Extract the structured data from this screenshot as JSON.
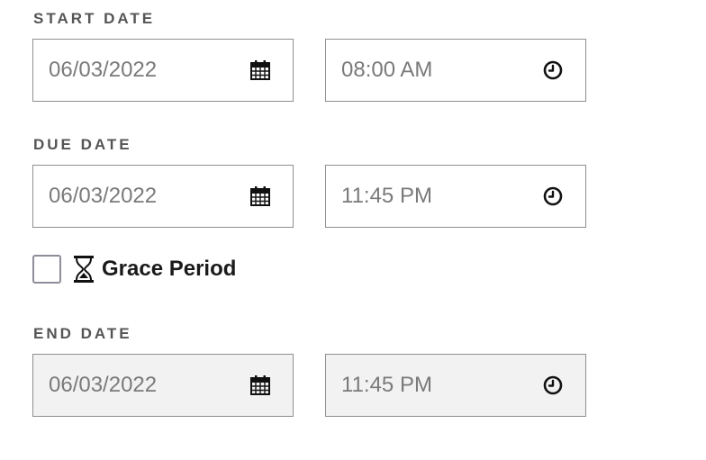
{
  "start_date": {
    "label": "START DATE",
    "date_value": "06/03/2022",
    "time_value": "08:00 AM"
  },
  "due_date": {
    "label": "DUE DATE",
    "date_value": "06/03/2022",
    "time_value": "11:45 PM"
  },
  "grace_period": {
    "label": "Grace Period",
    "checked": false,
    "icon": "hourglass-icon"
  },
  "end_date": {
    "label": "END DATE",
    "date_value": "06/03/2022",
    "time_value": "11:45 PM",
    "disabled": true
  },
  "icons": {
    "date": "calendar-icon",
    "time": "clock-icon"
  }
}
